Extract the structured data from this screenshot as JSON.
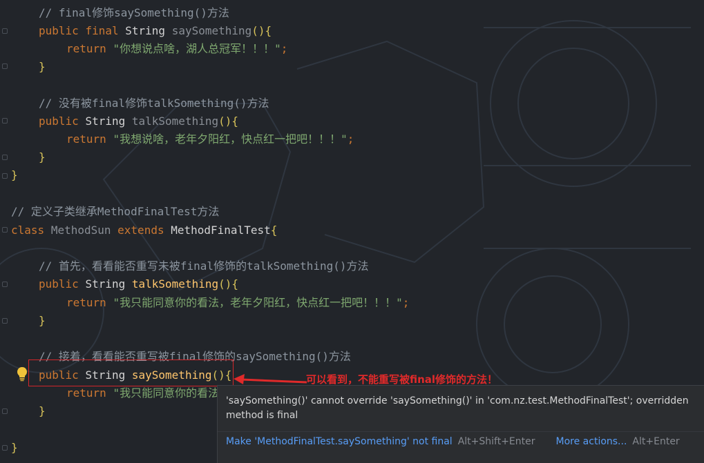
{
  "editor": {
    "lines": {
      "c1": "// final修饰saySomething()方法",
      "l2_public": "public",
      "l2_final": "final",
      "l2_type": "String",
      "l2_method": "saySomething",
      "l2_parens": "()",
      "l2_brace": "{",
      "l3_return": "return",
      "l3_str": "\"你想说点啥，湖人总冠军！！！\"",
      "l3_semi": ";",
      "l4_brace": "}",
      "c6": "// 没有被final修饰talkSomething()方法",
      "l7_public": "public",
      "l7_type": "String",
      "l7_method": "talkSomething",
      "l7_parens": "()",
      "l7_brace": "{",
      "l8_return": "return",
      "l8_str": "\"我想说啥，老年夕阳红，快点红一把吧！！！\"",
      "l8_semi": ";",
      "l9_brace": "}",
      "l10_brace": "}",
      "c12": "// 定义子类继承MethodFinalTest方法",
      "l13_class": "class",
      "l13_name": "MethodSun",
      "l13_extends": "extends",
      "l13_parent": "MethodFinalTest",
      "l13_brace": "{",
      "c15": "// 首先，看看能否重写未被final修饰的talkSomething()方法",
      "l16_public": "public",
      "l16_type": "String",
      "l16_method": "talkSomething",
      "l16_parens": "()",
      "l16_brace": "{",
      "l17_return": "return",
      "l17_str": "\"我只能同意你的看法，老年夕阳红，快点红一把吧！！！\"",
      "l17_semi": ";",
      "l18_brace": "}",
      "c20": "// 接着，看看能否重写被final修饰的saySomething()方法",
      "l21_public": "public",
      "l21_type": "String",
      "l21_method": "saySomething",
      "l21_parens": "()",
      "l21_brace": "{",
      "l22_return": "return",
      "l22_str": "\"我只能同意你的看法",
      "l23_brace": "}",
      "l25_brace": "}"
    }
  },
  "annotation": {
    "text": "可以看到，不能重写被final修饰的方法！",
    "color": "#e02a2a"
  },
  "popup": {
    "message": "'saySomething()' cannot override 'saySomething()' in 'com.nz.test.MethodFinalTest'; overridden method is final",
    "action1_label": "Make 'MethodFinalTest.saySomething' not final",
    "action1_shortcut": "Alt+Shift+Enter",
    "action2_label": "More actions...",
    "action2_shortcut": "Alt+Enter"
  },
  "icons": {
    "intention": "lightbulb-icon",
    "fold": "fold-marker-icon"
  },
  "colors": {
    "background": "#22252a",
    "keyword": "#cc7832",
    "method": "#ffc66d",
    "string": "#7fa86f",
    "comment": "#8c959f",
    "link": "#589df6"
  }
}
